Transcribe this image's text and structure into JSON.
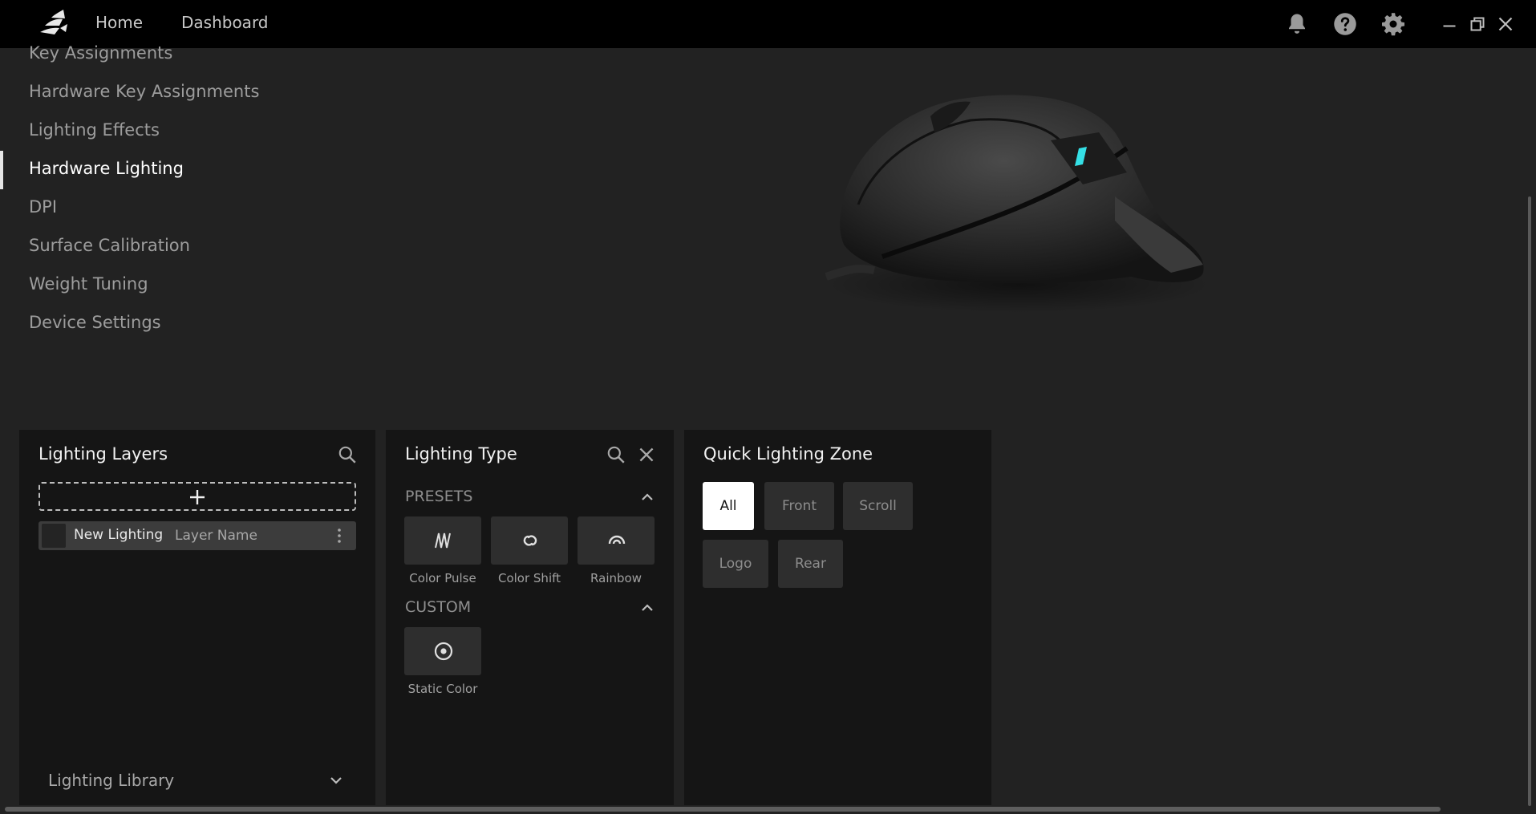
{
  "titlebar": {
    "nav": {
      "home": "Home",
      "dashboard": "Dashboard"
    },
    "icons": [
      "bell-icon",
      "help-icon",
      "gear-icon",
      "minimize-icon",
      "restore-icon",
      "close-icon"
    ]
  },
  "sidebar": {
    "items": [
      {
        "label": "Key Assignments"
      },
      {
        "label": "Hardware Key Assignments"
      },
      {
        "label": "Lighting Effects"
      },
      {
        "label": "Hardware Lighting",
        "active": true
      },
      {
        "label": "DPI"
      },
      {
        "label": "Surface Calibration"
      },
      {
        "label": "Weight Tuning"
      },
      {
        "label": "Device Settings"
      }
    ]
  },
  "layers_panel": {
    "title": "Lighting Layers",
    "layer": {
      "name": "New Lighting",
      "placeholder": "Layer Name"
    },
    "library_label": "Lighting Library"
  },
  "type_panel": {
    "title": "Lighting Type",
    "presets_label": "PRESETS",
    "presets": [
      "Color Pulse",
      "Color Shift",
      "Rainbow"
    ],
    "custom_label": "CUSTOM",
    "custom": [
      "Static Color"
    ]
  },
  "zone_panel": {
    "title": "Quick Lighting Zone",
    "zones": [
      {
        "label": "All",
        "selected": true
      },
      {
        "label": "Front"
      },
      {
        "label": "Scroll"
      },
      {
        "label": "Logo"
      },
      {
        "label": "Rear"
      }
    ]
  },
  "colors": {
    "background": "#222222",
    "panel": "#151515",
    "titlebar": "#000000",
    "accent_led": "#35e0e6"
  }
}
